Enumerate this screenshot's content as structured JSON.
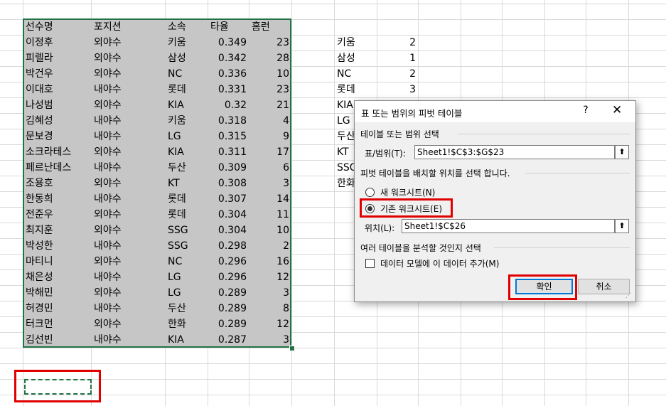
{
  "table": {
    "headers": [
      "선수명",
      "포지션",
      "소속",
      "타율",
      "홈런"
    ],
    "rows": [
      [
        "이정후",
        "외야수",
        "키움",
        "0.349",
        "23"
      ],
      [
        "피렐라",
        "외야수",
        "삼성",
        "0.342",
        "28"
      ],
      [
        "박건우",
        "외야수",
        "NC",
        "0.336",
        "10"
      ],
      [
        "이대호",
        "내야수",
        "롯데",
        "0.331",
        "23"
      ],
      [
        "나성범",
        "외야수",
        "KIA",
        "0.32",
        "21"
      ],
      [
        "김혜성",
        "내야수",
        "키움",
        "0.318",
        "4"
      ],
      [
        "문보경",
        "내야수",
        "LG",
        "0.315",
        "9"
      ],
      [
        "소크라테스",
        "외야수",
        "KIA",
        "0.311",
        "17"
      ],
      [
        "페르난데스",
        "내야수",
        "두산",
        "0.309",
        "6"
      ],
      [
        "조용호",
        "외야수",
        "KT",
        "0.308",
        "3"
      ],
      [
        "한동희",
        "내야수",
        "롯데",
        "0.307",
        "14"
      ],
      [
        "전준우",
        "외야수",
        "롯데",
        "0.304",
        "11"
      ],
      [
        "최지훈",
        "외야수",
        "SSG",
        "0.304",
        "10"
      ],
      [
        "박성한",
        "내야수",
        "SSG",
        "0.298",
        "2"
      ],
      [
        "마티니",
        "외야수",
        "NC",
        "0.296",
        "16"
      ],
      [
        "채은성",
        "내야수",
        "LG",
        "0.296",
        "12"
      ],
      [
        "박해민",
        "외야수",
        "LG",
        "0.289",
        "3"
      ],
      [
        "허경민",
        "내야수",
        "두산",
        "0.289",
        "8"
      ],
      [
        "터크먼",
        "외야수",
        "한화",
        "0.289",
        "12"
      ],
      [
        "김선빈",
        "내야수",
        "KIA",
        "0.287",
        "3"
      ]
    ]
  },
  "team_counts": [
    {
      "team": "키움",
      "count": "2"
    },
    {
      "team": "삼성",
      "count": "1"
    },
    {
      "team": "NC",
      "count": "2"
    },
    {
      "team": "롯데",
      "count": "3"
    },
    {
      "team": "KIA",
      "count": ""
    },
    {
      "team": "LG",
      "count": ""
    },
    {
      "team": "두산",
      "count": ""
    },
    {
      "team": "KT",
      "count": ""
    },
    {
      "team": "SSG",
      "count": ""
    },
    {
      "team": "한화",
      "count": ""
    }
  ],
  "dialog": {
    "title": "표 또는 범위의 피벗 테이블",
    "help": "?",
    "close": "✕",
    "section_range": "테이블 또는 범위 선택",
    "range_label": "표/범위(T):",
    "range_value": "Sheet1!$C$3:$G$23",
    "section_location": "피벗 테이블을 배치할 위치를 선택 합니다.",
    "option_new": "새 워크시트(N)",
    "option_existing": "기존 워크시트(E)",
    "location_label": "위치(L):",
    "location_value": "Sheet1!$C$26",
    "section_multi": "여러 테이블을 분석할 것인지 선택",
    "data_model": "데이터 모델에 이 데이터 추가(M)",
    "ok": "확인",
    "cancel": "취소",
    "collapse_icon": "up-arrow-icon"
  },
  "colors": {
    "selection_fill": "#c6c6c6",
    "selection_border": "#217346",
    "highlight": "#e00000"
  }
}
